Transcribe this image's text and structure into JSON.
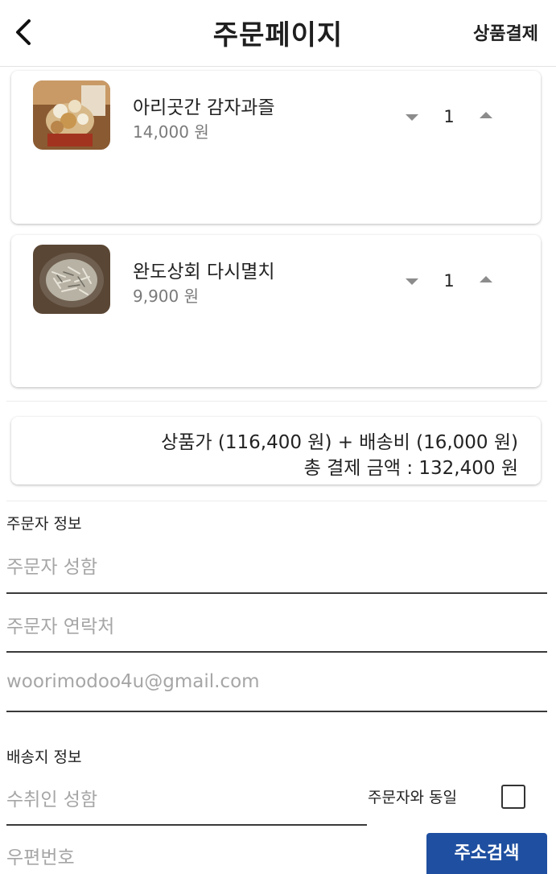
{
  "header": {
    "title": "주문페이지",
    "back_icon": "chevron-left-icon",
    "checkout_label": "상품결제"
  },
  "products": [
    {
      "name": "아리곳간 감자과즐",
      "price": "14,000 원",
      "quantity": "1",
      "image": "potato-snack-photo"
    },
    {
      "name": "완도상회 다시멸치",
      "price": "9,900 원",
      "quantity": "1",
      "image": "dried-anchovy-photo"
    }
  ],
  "summary": {
    "line1": "상품가 (116,400 원) + 배송비 (16,000 원)",
    "line2": "총 결제 금액 : 132,400 원"
  },
  "orderer": {
    "section_label": "주문자 정보",
    "name_placeholder": "주문자 성함",
    "phone_placeholder": "주문자 연락처",
    "email_value": "woorimodoo4u@gmail.com"
  },
  "shipping": {
    "section_label": "배송지 정보",
    "recipient_placeholder": "수취인 성함",
    "same_as_orderer_label": "주문자와 동일",
    "same_as_orderer_checked": false,
    "postcode_placeholder": "우편번호",
    "address_search_label": "주소검색"
  },
  "colors": {
    "accent": "#1f4fa0",
    "muted_text": "#a6a6a6",
    "price_text": "#7a7a7a"
  }
}
